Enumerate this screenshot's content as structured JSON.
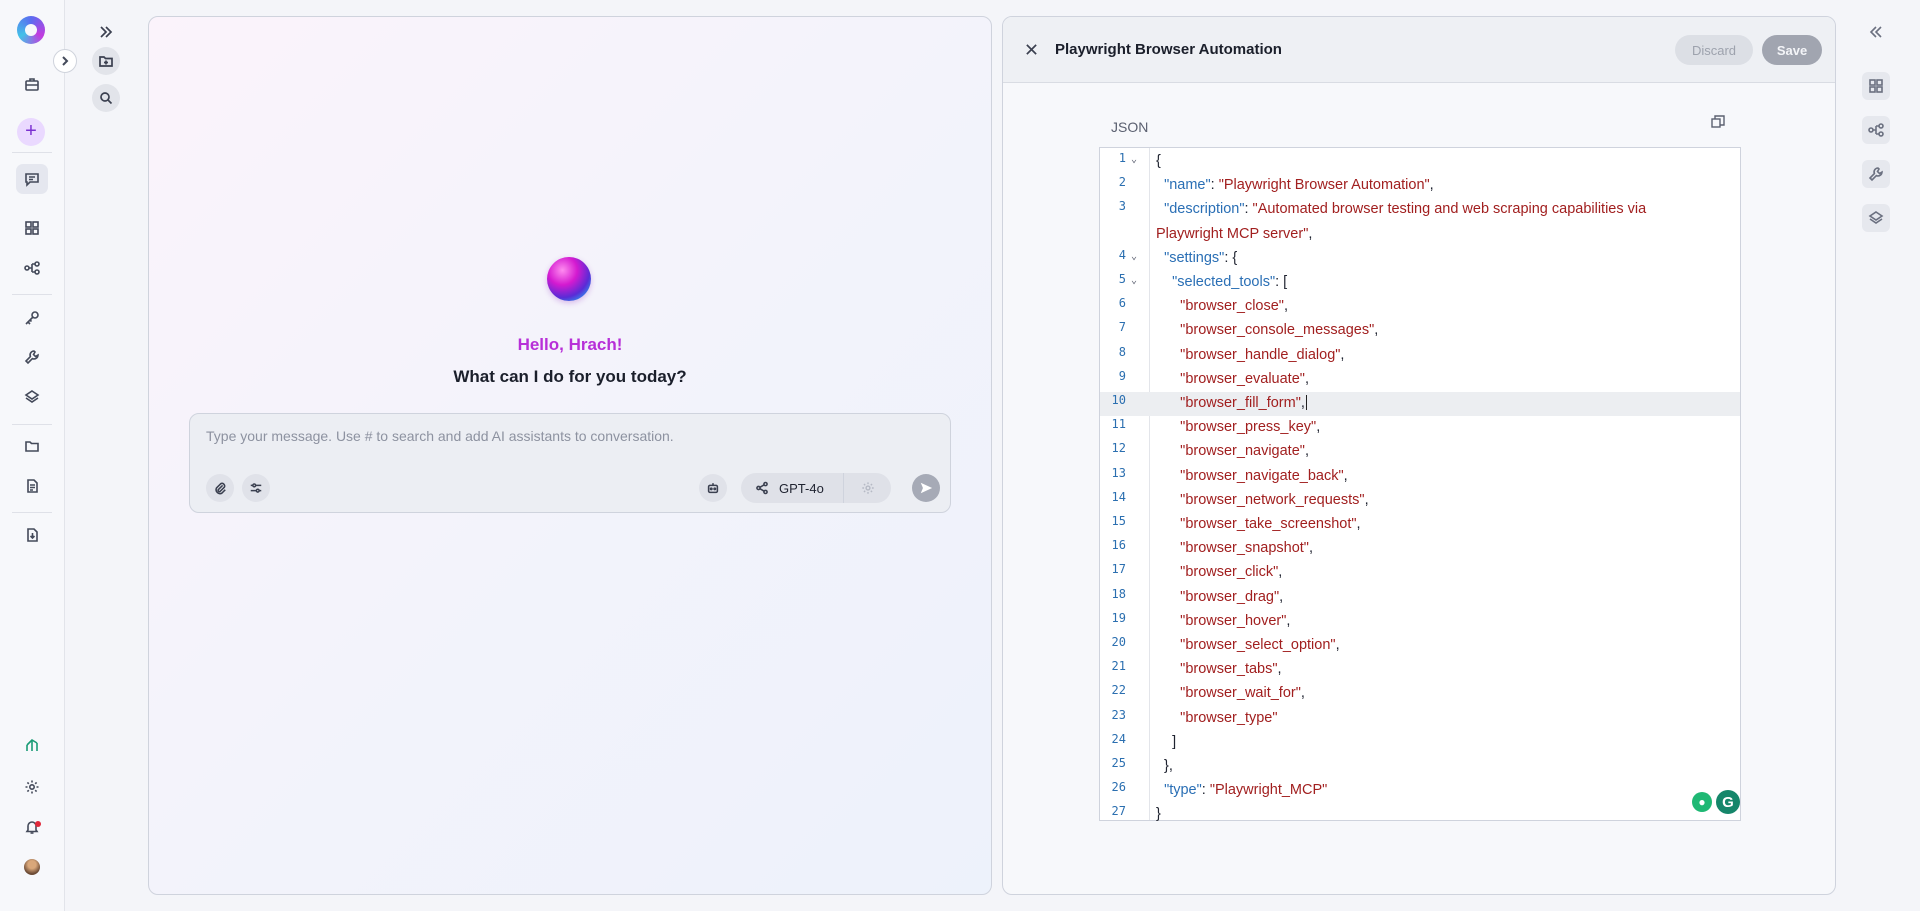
{
  "rail": {
    "icons": [
      "app-logo",
      "briefcase-icon",
      "plus-icon",
      "chat-icon",
      "grid-icon",
      "workflow-icon",
      "key-icon",
      "wrench-icon",
      "layers-icon",
      "folder-icon",
      "document-icon",
      "export-icon",
      "analytics-icon",
      "settings-icon",
      "bell-icon",
      "user-avatar"
    ],
    "plus_label": "+"
  },
  "chat": {
    "greeting": "Hello, Hrach!",
    "question": "What can I do for you today?",
    "input_placeholder": "Type your message. Use # to search and add AI assistants to conversation.",
    "model": "GPT-4o"
  },
  "editor": {
    "title": "Playwright Browser Automation",
    "discard_label": "Discard",
    "save_label": "Save",
    "format_label": "JSON",
    "active_line": 10,
    "lines": [
      {
        "n": "1",
        "fold": true,
        "parts": [
          [
            "p",
            "{"
          ]
        ]
      },
      {
        "n": "2",
        "parts": [
          [
            "p",
            "  "
          ],
          [
            "k",
            "\"name\""
          ],
          [
            "p",
            ": "
          ],
          [
            "s",
            "\"Playwright Browser Automation\""
          ],
          [
            "p",
            ","
          ]
        ]
      },
      {
        "n": "3",
        "parts": [
          [
            "p",
            "  "
          ],
          [
            "k",
            "\"description\""
          ],
          [
            "p",
            ": "
          ],
          [
            "s",
            "\"Automated browser testing and web scraping capabilities via"
          ]
        ]
      },
      {
        "n": "",
        "parts": [
          [
            "s",
            "Playwright MCP server\""
          ],
          [
            "p",
            ","
          ]
        ]
      },
      {
        "n": "4",
        "fold": true,
        "parts": [
          [
            "p",
            "  "
          ],
          [
            "k",
            "\"settings\""
          ],
          [
            "p",
            ": {"
          ]
        ]
      },
      {
        "n": "5",
        "fold": true,
        "parts": [
          [
            "p",
            "    "
          ],
          [
            "k",
            "\"selected_tools\""
          ],
          [
            "p",
            ": ["
          ]
        ]
      },
      {
        "n": "6",
        "parts": [
          [
            "p",
            "      "
          ],
          [
            "s",
            "\"browser_close\""
          ],
          [
            "p",
            ","
          ]
        ]
      },
      {
        "n": "7",
        "parts": [
          [
            "p",
            "      "
          ],
          [
            "s",
            "\"browser_console_messages\""
          ],
          [
            "p",
            ","
          ]
        ]
      },
      {
        "n": "8",
        "parts": [
          [
            "p",
            "      "
          ],
          [
            "s",
            "\"browser_handle_dialog\""
          ],
          [
            "p",
            ","
          ]
        ]
      },
      {
        "n": "9",
        "parts": [
          [
            "p",
            "      "
          ],
          [
            "s",
            "\"browser_evaluate\""
          ],
          [
            "p",
            ","
          ]
        ]
      },
      {
        "n": "10",
        "parts": [
          [
            "p",
            "      "
          ],
          [
            "s",
            "\"browser_fill_form\""
          ],
          [
            "p",
            ","
          ]
        ]
      },
      {
        "n": "11",
        "parts": [
          [
            "p",
            "      "
          ],
          [
            "s",
            "\"browser_press_key\""
          ],
          [
            "p",
            ","
          ]
        ]
      },
      {
        "n": "12",
        "parts": [
          [
            "p",
            "      "
          ],
          [
            "s",
            "\"browser_navigate\""
          ],
          [
            "p",
            ","
          ]
        ]
      },
      {
        "n": "13",
        "parts": [
          [
            "p",
            "      "
          ],
          [
            "s",
            "\"browser_navigate_back\""
          ],
          [
            "p",
            ","
          ]
        ]
      },
      {
        "n": "14",
        "parts": [
          [
            "p",
            "      "
          ],
          [
            "s",
            "\"browser_network_requests\""
          ],
          [
            "p",
            ","
          ]
        ]
      },
      {
        "n": "15",
        "parts": [
          [
            "p",
            "      "
          ],
          [
            "s",
            "\"browser_take_screenshot\""
          ],
          [
            "p",
            ","
          ]
        ]
      },
      {
        "n": "16",
        "parts": [
          [
            "p",
            "      "
          ],
          [
            "s",
            "\"browser_snapshot\""
          ],
          [
            "p",
            ","
          ]
        ]
      },
      {
        "n": "17",
        "parts": [
          [
            "p",
            "      "
          ],
          [
            "s",
            "\"browser_click\""
          ],
          [
            "p",
            ","
          ]
        ]
      },
      {
        "n": "18",
        "parts": [
          [
            "p",
            "      "
          ],
          [
            "s",
            "\"browser_drag\""
          ],
          [
            "p",
            ","
          ]
        ]
      },
      {
        "n": "19",
        "parts": [
          [
            "p",
            "      "
          ],
          [
            "s",
            "\"browser_hover\""
          ],
          [
            "p",
            ","
          ]
        ]
      },
      {
        "n": "20",
        "parts": [
          [
            "p",
            "      "
          ],
          [
            "s",
            "\"browser_select_option\""
          ],
          [
            "p",
            ","
          ]
        ]
      },
      {
        "n": "21",
        "parts": [
          [
            "p",
            "      "
          ],
          [
            "s",
            "\"browser_tabs\""
          ],
          [
            "p",
            ","
          ]
        ]
      },
      {
        "n": "22",
        "parts": [
          [
            "p",
            "      "
          ],
          [
            "s",
            "\"browser_wait_for\""
          ],
          [
            "p",
            ","
          ]
        ]
      },
      {
        "n": "23",
        "parts": [
          [
            "p",
            "      "
          ],
          [
            "s",
            "\"browser_type\""
          ]
        ]
      },
      {
        "n": "24",
        "parts": [
          [
            "p",
            "    ]"
          ]
        ]
      },
      {
        "n": "25",
        "parts": [
          [
            "p",
            "  },"
          ]
        ]
      },
      {
        "n": "26",
        "parts": [
          [
            "p",
            "  "
          ],
          [
            "k",
            "\"type\""
          ],
          [
            "p",
            ": "
          ],
          [
            "s",
            "\"Playwright_MCP\""
          ]
        ]
      },
      {
        "n": "27",
        "parts": [
          [
            "p",
            "}"
          ]
        ]
      }
    ]
  },
  "colors": {
    "accent": "#b72fd8",
    "json_key": "#2a6fb5",
    "json_string": "#a11f1f",
    "line_number": "#2b6fb0"
  }
}
